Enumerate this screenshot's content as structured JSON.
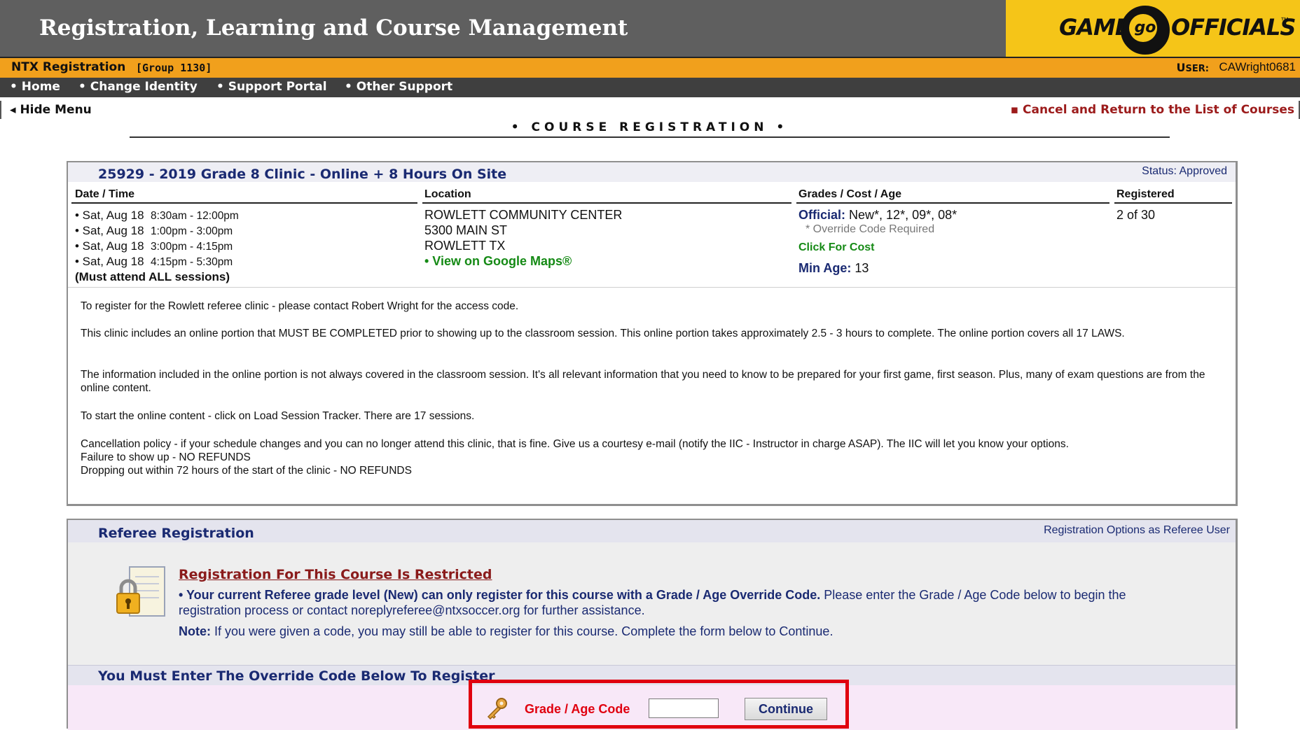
{
  "header": {
    "title": "Registration, Learning and Course Management",
    "logo": {
      "left": "GAME",
      "mark": "go",
      "right": "OFFICIALS",
      "tm": "™",
      "accent": "#f5c518"
    }
  },
  "subheader": {
    "app": "NTX Registration",
    "group": "[Group 1130]",
    "user_label": "User:",
    "user_value": "CAWright0681"
  },
  "nav": {
    "items": [
      "• Home",
      "• Change Identity",
      "• Support Portal",
      "• Other Support"
    ]
  },
  "menubar": {
    "hide_menu": "◂ Hide Menu",
    "cancel": "▪ Cancel and Return to the List of Courses"
  },
  "page_title": "• COURSE REGISTRATION •",
  "course": {
    "title": "25929 - 2019 Grade 8 Clinic - Online + 8 Hours On Site",
    "status": "Status: Approved",
    "columns": [
      "Date / Time",
      "Location",
      "Grades / Cost / Age",
      "Registered"
    ],
    "sessions": [
      {
        "day": "• Sat, Aug 18",
        "time": "8:30am - 12:00pm"
      },
      {
        "day": "• Sat, Aug 18",
        "time": "1:00pm - 3:00pm"
      },
      {
        "day": "• Sat, Aug 18",
        "time": "3:00pm - 4:15pm"
      },
      {
        "day": "• Sat, Aug 18",
        "time": "4:15pm - 5:30pm"
      }
    ],
    "must_attend": "(Must attend ALL sessions)",
    "location": {
      "name": "ROWLETT COMMUNITY CENTER",
      "street": "5300 MAIN ST",
      "city": "ROWLETT TX",
      "map_link": "• View on Google Maps®"
    },
    "grades": {
      "official_label": "Official:",
      "official_value": "New*, 12*, 09*, 08*",
      "override_note": "* Override Code Required",
      "cost_link": "Click For Cost",
      "min_age_label": "Min Age:",
      "min_age_value": "13"
    },
    "registered": "2 of 30",
    "description": [
      "To register for the Rowlett referee clinic - please contact Robert Wright for the access code.",
      "This clinic includes an online portion that MUST BE COMPLETED prior to showing up to the classroom session. This online portion takes approximately 2.5 - 3 hours to complete. The online portion covers all 17 LAWS.",
      "The information included in the online portion is not always covered in the classroom session. It's all relevant information that you need to know to be prepared for your first game, first season. Plus, many of exam questions are from the online content.",
      "To start the online content - click on Load Session Tracker. There are 17 sessions.",
      "Cancellation policy - if your schedule changes and you can no longer attend this clinic, that is fine. Give us a courtesy e-mail (notify the IIC - Instructor in charge ASAP). The IIC will let you know your options.",
      "Failure to show up - NO REFUNDS",
      "Dropping out within 72 hours of the start of the clinic - NO REFUNDS"
    ]
  },
  "referee": {
    "title": "Referee Registration",
    "options_link": "Registration Options as Referee User",
    "restricted_title": "Registration For This Course Is Restricted",
    "msg_bold": "• Your current Referee grade level (New) can only register for this course with a Grade / Age Override Code.",
    "msg_rest": " Please enter the Grade / Age Code below to begin the registration process or contact noreplyreferee@ntxsoccer.org for further assistance.",
    "note_label": "Note:",
    "note_text": " If you were given a code, you may still be able to register for this course. Complete the form below to Continue.",
    "must_enter": "You Must Enter The Override Code Below To Register",
    "code_label": "Grade / Age Code",
    "code_value": "",
    "continue_label": "Continue"
  }
}
